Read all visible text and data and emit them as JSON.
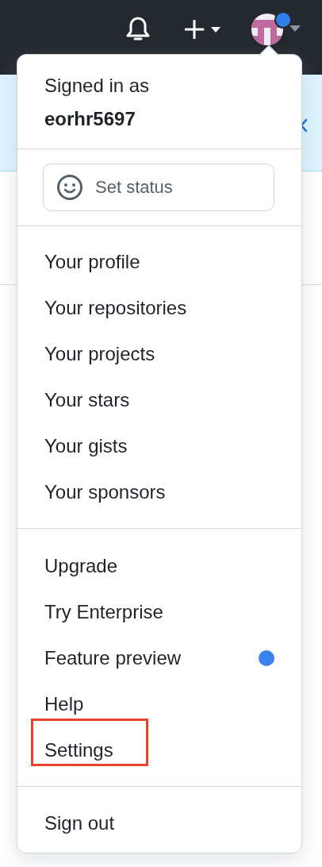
{
  "header": {
    "notifications": true
  },
  "account_menu": {
    "signed_in_label": "Signed in as",
    "username": "eorhr5697",
    "status_button": "Set status",
    "groups": [
      {
        "items": [
          {
            "label": "Your profile",
            "badge": false,
            "highlighted": false
          },
          {
            "label": "Your repositories",
            "badge": false,
            "highlighted": false
          },
          {
            "label": "Your projects",
            "badge": false,
            "highlighted": false
          },
          {
            "label": "Your stars",
            "badge": false,
            "highlighted": false
          },
          {
            "label": "Your gists",
            "badge": false,
            "highlighted": false
          },
          {
            "label": "Your sponsors",
            "badge": false,
            "highlighted": false
          }
        ]
      },
      {
        "items": [
          {
            "label": "Upgrade",
            "badge": false,
            "highlighted": false
          },
          {
            "label": "Try Enterprise",
            "badge": false,
            "highlighted": false
          },
          {
            "label": "Feature preview",
            "badge": true,
            "highlighted": false
          },
          {
            "label": "Help",
            "badge": false,
            "highlighted": false
          },
          {
            "label": "Settings",
            "badge": false,
            "highlighted": true
          }
        ]
      },
      {
        "items": [
          {
            "label": "Sign out",
            "badge": false,
            "highlighted": false
          }
        ]
      }
    ]
  }
}
